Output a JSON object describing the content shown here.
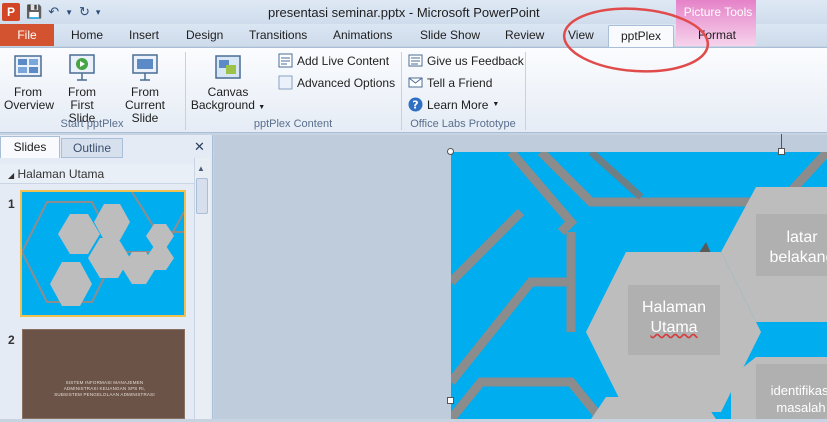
{
  "window": {
    "title": "presentasi seminar.pptx - Microsoft PowerPoint",
    "context_group": "Picture Tools"
  },
  "tabs": {
    "file": "File",
    "items": [
      "Home",
      "Insert",
      "Design",
      "Transitions",
      "Animations",
      "Slide Show",
      "Review",
      "View",
      "pptPlex",
      "Format"
    ],
    "active": "pptPlex"
  },
  "ribbon": {
    "start_group": {
      "label": "Start pptPlex",
      "from_overview": [
        "From",
        "Overview"
      ],
      "from_first": [
        "From",
        "First Slide"
      ],
      "from_current": [
        "From",
        "Current Slide"
      ]
    },
    "content_group": {
      "label": "pptPlex Content",
      "canvas_background": [
        "Canvas",
        "Background"
      ],
      "add_live_content": "Add Live Content",
      "advanced_options": "Advanced Options"
    },
    "labs_group": {
      "label": "Office Labs Prototype",
      "give_feedback": "Give us Feedback",
      "tell_friend": "Tell a Friend",
      "learn_more": "Learn More"
    }
  },
  "panel": {
    "tab_slides": "Slides",
    "tab_outline": "Outline",
    "section": "Halaman Utama",
    "slides": [
      {
        "number": "1"
      },
      {
        "number": "2",
        "text": [
          "SISTEM INFORMASI MANAJEMEN",
          "ADMINISTRASI KEUANGAN SPS RI,",
          "SUBSISTEM PENGELOLAAN ADMINISTRASI"
        ]
      }
    ]
  },
  "slide": {
    "main_hex": [
      "Halaman",
      "Utama"
    ],
    "right_top_hex": [
      "latar",
      "belakang"
    ],
    "right_bottom_hex": [
      "identifikasi",
      "masalah"
    ]
  },
  "colors": {
    "slide_bg": "#00adef",
    "hex_fill": "#bdbdbd",
    "file_tab": "#d35230",
    "annotation": "#e04b4b"
  }
}
